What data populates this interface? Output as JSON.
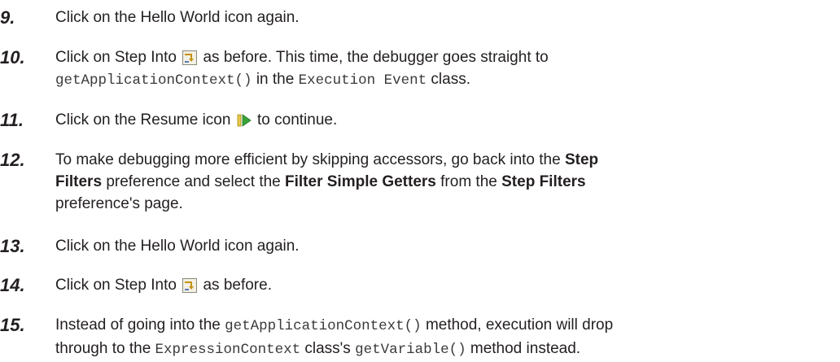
{
  "steps": [
    {
      "num": "9.",
      "text": "Click on the Hello World icon again."
    },
    {
      "num": "10.",
      "t1": "Click on Step Into",
      "t2": "as before. This time, the debugger goes straight to",
      "c1": "getApplicationContext()",
      "t3": "in the",
      "c2": "Execution Event",
      "t4": "class."
    },
    {
      "num": "11.",
      "t1": "Click on the Resume icon",
      "t2": "to continue."
    },
    {
      "num": "12.",
      "t1": "To make debugging more efficient by skipping accessors, go back into the",
      "b1": "Step",
      "b2": "Filters",
      "t2": "preference and select the",
      "b3": "Filter Simple Getters",
      "t3": "from the",
      "b4": "Step Filters",
      "t4": "preference's page."
    },
    {
      "num": "13.",
      "text": "Click on the Hello World icon again."
    },
    {
      "num": "14.",
      "t1": "Click on Step Into",
      "t2": "as before."
    },
    {
      "num": "15.",
      "t1": "Instead of going into the",
      "c1": "getApplicationContext()",
      "t2": "method, execution will drop",
      "t3": "through to the",
      "c2": "ExpressionContext",
      "t4": "class's",
      "c3": "getVariable()",
      "t5": "method instead."
    }
  ],
  "icons": {
    "step_into": "step-into-icon",
    "resume": "resume-icon"
  }
}
